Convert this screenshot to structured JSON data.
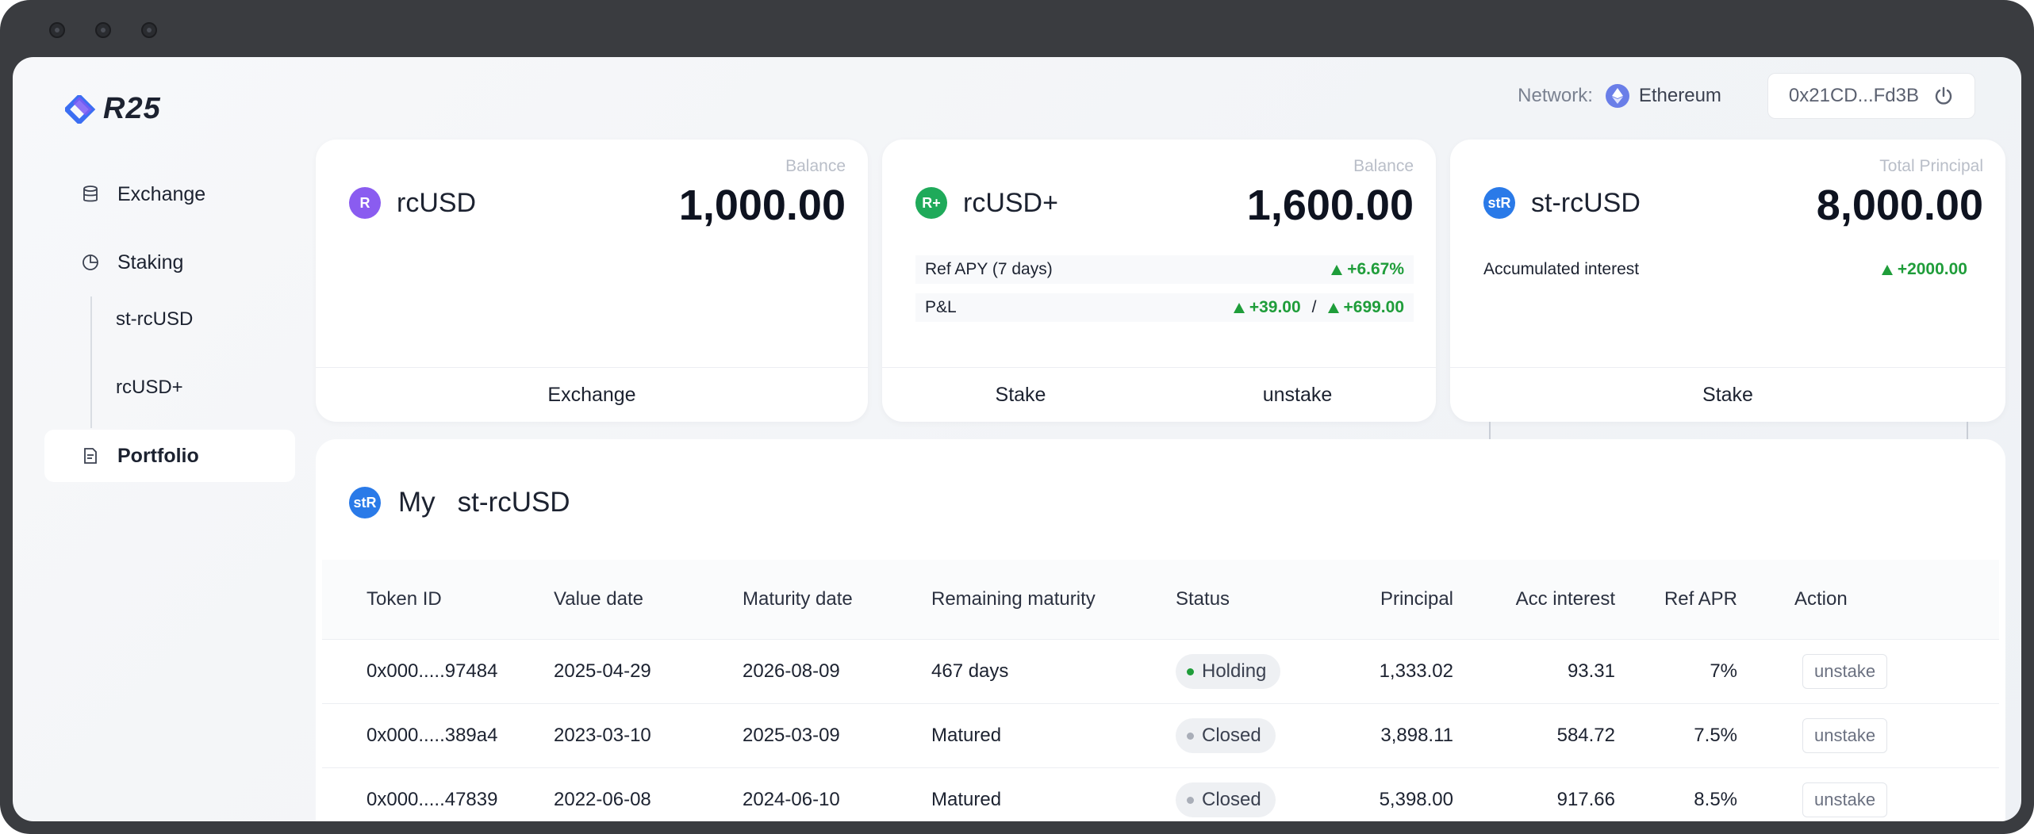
{
  "brand": {
    "name": "R25"
  },
  "header": {
    "network_label": "Network:",
    "network_name": "Ethereum",
    "wallet_address": "0x21CD...Fd3B"
  },
  "sidebar": {
    "items": [
      {
        "label": "Exchange",
        "icon": "database-icon"
      },
      {
        "label": "Staking",
        "icon": "pie-chart-icon"
      },
      {
        "label": "Portfolio",
        "icon": "document-icon"
      }
    ],
    "sub_items": [
      {
        "label": "st-rcUSD"
      },
      {
        "label": "rcUSD+"
      }
    ]
  },
  "cards": [
    {
      "token": "rcUSD",
      "icon_text": "R",
      "icon_color": "#8a5cf0",
      "amount_label": "Balance",
      "amount": "1,000.00",
      "actions": [
        "Exchange"
      ]
    },
    {
      "token": "rcUSD+",
      "icon_text": "R+",
      "icon_color": "#1faa5a",
      "amount_label": "Balance",
      "amount": "1,600.00",
      "apy_label": "Ref APY (7 days)",
      "apy_value": "+6.67%",
      "pnl_label": "P&L",
      "pnl_value_1": "+39.00",
      "pnl_sep": "/",
      "pnl_value_2": "+699.00",
      "actions": [
        "Stake",
        "unstake"
      ]
    },
    {
      "token": "st-rcUSD",
      "icon_text": "stR",
      "icon_color": "#2a7ae8",
      "amount_label": "Total Principal",
      "amount": "8,000.00",
      "interest_label": "Accumulated interest",
      "interest_value": "+2000.00",
      "actions": [
        "Stake"
      ]
    }
  ],
  "portfolio": {
    "title_prefix": "My",
    "title_token": "st-rcUSD",
    "icon_text": "stR",
    "columns": [
      "Token ID",
      "Value date",
      "Maturity date",
      "Remaining maturity",
      "Status",
      "Principal",
      "Acc interest",
      "Ref APR",
      "Action"
    ],
    "rows": [
      {
        "token_id": "0x000.....97484",
        "value_date": "2025-04-29",
        "maturity_date": "2026-08-09",
        "remaining": "467 days",
        "status": "Holding",
        "status_color": "#1f9d3a",
        "principal": "1,333.02",
        "acc_interest": "93.31",
        "ref_apr": "7%",
        "action": "unstake"
      },
      {
        "token_id": "0x000.....389a4",
        "value_date": "2023-03-10",
        "maturity_date": "2025-03-09",
        "remaining": "Matured",
        "status": "Closed",
        "status_color": "#a9aeb8",
        "principal": "3,898.11",
        "acc_interest": "584.72",
        "ref_apr": "7.5%",
        "action": "unstake"
      },
      {
        "token_id": "0x000.....47839",
        "value_date": "2022-06-08",
        "maturity_date": "2024-06-10",
        "remaining": "Matured",
        "status": "Closed",
        "status_color": "#a9aeb8",
        "principal": "5,398.00",
        "acc_interest": "917.66",
        "ref_apr": "8.5%",
        "action": "unstake"
      }
    ]
  }
}
